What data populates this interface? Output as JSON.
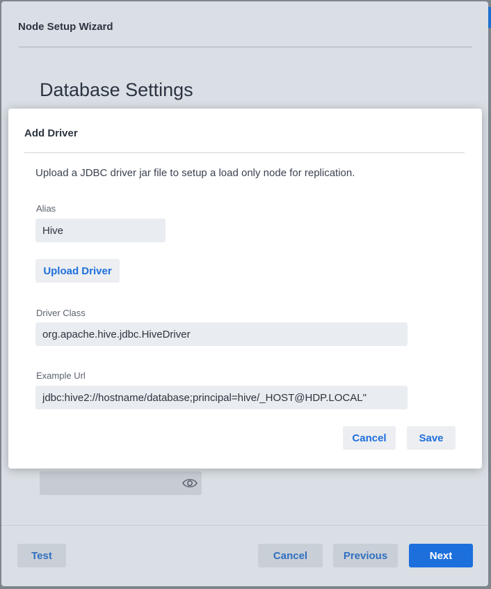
{
  "wizard": {
    "title": "Node Setup Wizard",
    "section_title": "Database Settings",
    "buttons": {
      "test": "Test",
      "cancel": "Cancel",
      "previous": "Previous",
      "next": "Next"
    }
  },
  "modal": {
    "title": "Add Driver",
    "description": "Upload a JDBC driver jar file to setup a load only node for replication.",
    "alias": {
      "label": "Alias",
      "value": "Hive"
    },
    "upload_button": "Upload Driver",
    "driver_class": {
      "label": "Driver Class",
      "value": "org.apache.hive.jdbc.HiveDriver"
    },
    "example_url": {
      "label": "Example Url",
      "value": "jdbc:hive2://hostname/database;principal=hive/_HOST@HDP.LOCAL\""
    },
    "buttons": {
      "cancel": "Cancel",
      "save": "Save"
    }
  },
  "icons": {
    "password_toggle": "eye-icon"
  },
  "colors": {
    "accent": "#1d6fdc",
    "overlay": "#dadfe5",
    "modal_bg": "#ffffff"
  }
}
